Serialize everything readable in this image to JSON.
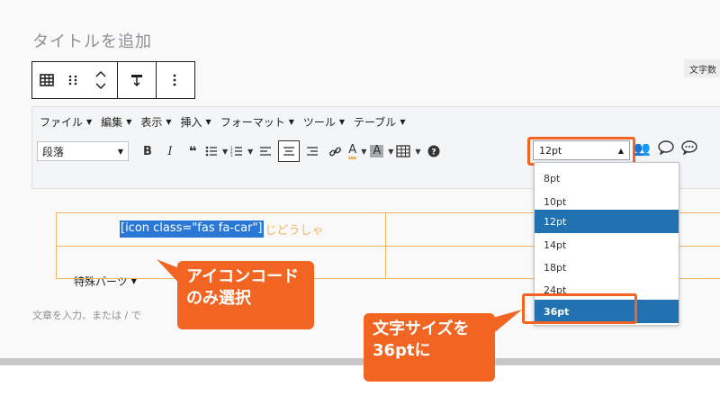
{
  "title_placeholder": "タイトルを追加",
  "char_count_label": "文字数",
  "block_toolbar": {
    "table_icon": "table-icon",
    "drag_icon": "drag-handle-icon",
    "move_icon": "move-updown-icon",
    "align_icon": "align-icon",
    "more_icon": "more-vertical-icon"
  },
  "menubar": [
    {
      "label": "ファイル",
      "caret": "▼"
    },
    {
      "label": "編集",
      "caret": "▼"
    },
    {
      "label": "表示",
      "caret": "▼"
    },
    {
      "label": "挿入",
      "caret": "▼"
    },
    {
      "label": "フォーマット",
      "caret": "▼"
    },
    {
      "label": "ツール",
      "caret": "▼"
    },
    {
      "label": "テーブル",
      "caret": "▼"
    }
  ],
  "toolbar": {
    "format_value": "段落",
    "bold": "B",
    "italic": "I",
    "quote": "❝"
  },
  "font_size": {
    "value": "12pt",
    "options": [
      "8pt",
      "10pt",
      "12pt",
      "14pt",
      "18pt",
      "24pt",
      "36pt"
    ],
    "selected": "12pt",
    "target": "36pt"
  },
  "special_parts": "特殊パーツ",
  "table": {
    "cell_code": "[icon class=\"fas fa-car\"]",
    "furigana": "じどうしゃ"
  },
  "content_placeholder": "文章を入力、または / で",
  "callouts": {
    "left_line1": "アイコンコード",
    "left_line2": "のみ選択",
    "right_line1": "文字サイズを",
    "right_line2": "36ptに"
  },
  "colors": {
    "accent": "#f26422",
    "selection": "#2271b1",
    "table_border": "#f0b663"
  }
}
